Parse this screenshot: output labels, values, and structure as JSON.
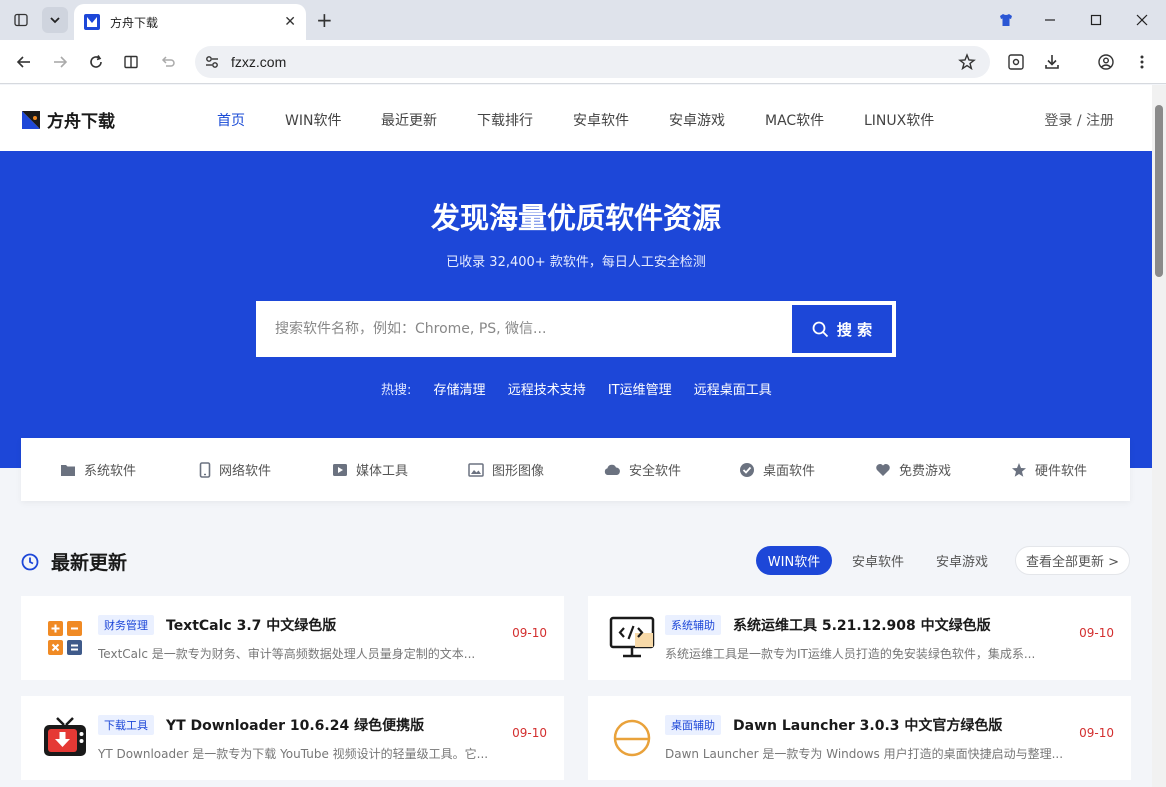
{
  "browser": {
    "tab_title": "方舟下载",
    "url": "fzxz.com"
  },
  "site": {
    "logo_text": "方舟下载",
    "nav": [
      {
        "label": "首页"
      },
      {
        "label": "WIN软件"
      },
      {
        "label": "最近更新"
      },
      {
        "label": "下载排行"
      },
      {
        "label": "安卓软件"
      },
      {
        "label": "安卓游戏"
      },
      {
        "label": "MAC软件"
      },
      {
        "label": "LINUX软件"
      }
    ],
    "login": "登录 / 注册"
  },
  "hero": {
    "title": "发现海量优质软件资源",
    "subtitle": "已收录 32,400+ 款软件，每日人工安全检测",
    "search_placeholder": "搜索软件名称，例如：Chrome, PS, 微信...",
    "search_button": "搜 索",
    "hot_label": "热搜:",
    "hot_items": [
      "存储清理",
      "远程技术支持",
      "IT运维管理",
      "远程桌面工具"
    ]
  },
  "categories": [
    {
      "label": "系统软件",
      "icon": "folder-icon"
    },
    {
      "label": "网络软件",
      "icon": "mobile-icon"
    },
    {
      "label": "媒体工具",
      "icon": "play-icon"
    },
    {
      "label": "图形图像",
      "icon": "image-icon"
    },
    {
      "label": "安全软件",
      "icon": "cloud-icon"
    },
    {
      "label": "桌面软件",
      "icon": "check-circle-icon"
    },
    {
      "label": "免费游戏",
      "icon": "heart-icon"
    },
    {
      "label": "硬件软件",
      "icon": "star-icon"
    }
  ],
  "latest": {
    "title": "最新更新",
    "tabs": [
      "WIN软件",
      "安卓软件",
      "安卓游戏"
    ],
    "view_all": "查看全部更新 >",
    "items": [
      {
        "badge": "财务管理",
        "title": "TextCalc 3.7 中文绿色版",
        "desc": "TextCalc 是一款专为财务、审计等高频数据处理人员量身定制的文本...",
        "date": "09-10",
        "icon": "calculator-icon"
      },
      {
        "badge": "系统辅助",
        "title": "系统运维工具 5.21.12.908 中文绿色版",
        "desc": "系统运维工具是一款专为IT运维人员打造的免安装绿色软件，集成系...",
        "date": "09-10",
        "icon": "code-monitor-icon"
      },
      {
        "badge": "下载工具",
        "title": "YT Downloader 10.6.24 绿色便携版",
        "desc": "YT Downloader 是一款专为下载 YouTube 视频设计的轻量级工具。它...",
        "date": "09-10",
        "icon": "tv-download-icon"
      },
      {
        "badge": "桌面辅助",
        "title": "Dawn Launcher 3.0.3 中文官方绿色版",
        "desc": "Dawn Launcher 是一款专为 Windows 用户打造的桌面快捷启动与整理...",
        "date": "09-10",
        "icon": "sunrise-icon"
      }
    ]
  },
  "colors": {
    "brand": "#1d47d8",
    "date": "#d32f2f"
  }
}
